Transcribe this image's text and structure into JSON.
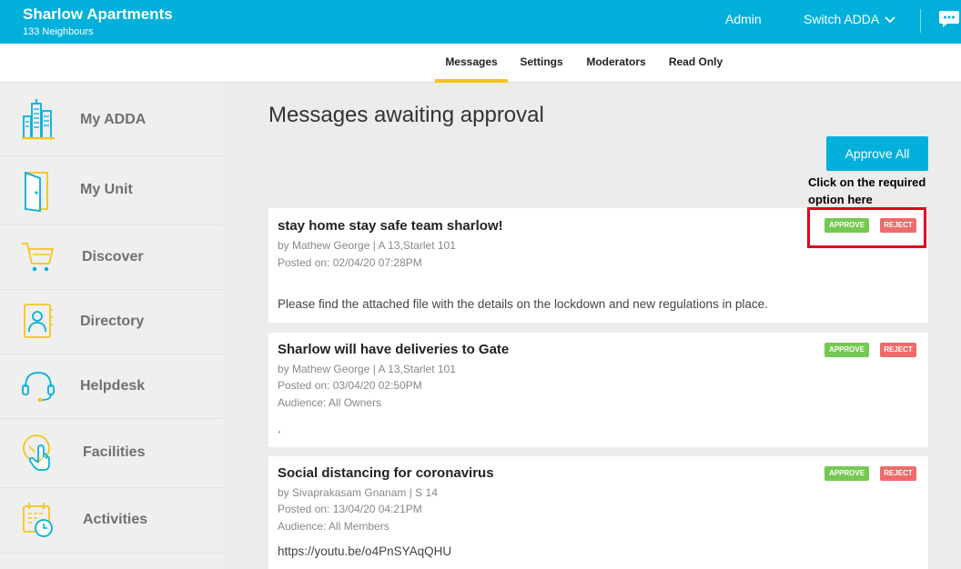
{
  "header": {
    "app_title": "Sharlow Apartments",
    "subtitle": "133 Neighbours",
    "admin_label": "Admin",
    "switch_label": "Switch ADDA",
    "icons": [
      "chevron-down-icon",
      "chat-icon"
    ]
  },
  "tabs": [
    {
      "label": "Messages",
      "active": true
    },
    {
      "label": "Settings"
    },
    {
      "label": "Moderators"
    },
    {
      "label": "Read Only"
    }
  ],
  "sidebar": {
    "items": [
      {
        "label": "My ADDA",
        "icon": "buildings-icon"
      },
      {
        "label": "My Unit",
        "icon": "door-icon"
      },
      {
        "label": "Discover",
        "icon": "cart-icon"
      },
      {
        "label": "Directory",
        "icon": "contact-book-icon"
      },
      {
        "label": "Helpdesk",
        "icon": "headset-icon"
      },
      {
        "label": "Facilities",
        "icon": "hand-pointer-icon"
      },
      {
        "label": "Activities",
        "icon": "calendar-clock-icon"
      }
    ]
  },
  "main": {
    "title": "Messages awaiting approval",
    "approve_all_label": "Approve All",
    "hint_text": "Click on the required option here",
    "approve_label": "APPROVE",
    "reject_label": "REJECT",
    "messages": [
      {
        "title": "stay home stay safe team sharlow!",
        "author": "by Mathew George | A 13,Starlet 101",
        "posted": "Posted on: 02/04/20 07:28PM",
        "body": "Please find the attached file with the details on the lockdown and new regulations in place."
      },
      {
        "title": "Sharlow will have deliveries to Gate",
        "author": "by Mathew George | A 13,Starlet 101",
        "posted": "Posted on: 03/04/20 02:50PM",
        "audience": "Audience: All Owners",
        "body": "."
      },
      {
        "title": "Social distancing for coronavirus",
        "author": "by Sivaprakasam Gnanam | S 14",
        "posted": "Posted on: 13/04/20 04:21PM",
        "audience": "Audience: All Members",
        "body": "https://youtu.be/o4PnSYAqQHU"
      }
    ]
  },
  "colors": {
    "brand": "#00b0db",
    "active_tab": "#f5c518",
    "approve": "#76c852",
    "reject": "#ef6b6b",
    "highlight": "#e4001b"
  }
}
